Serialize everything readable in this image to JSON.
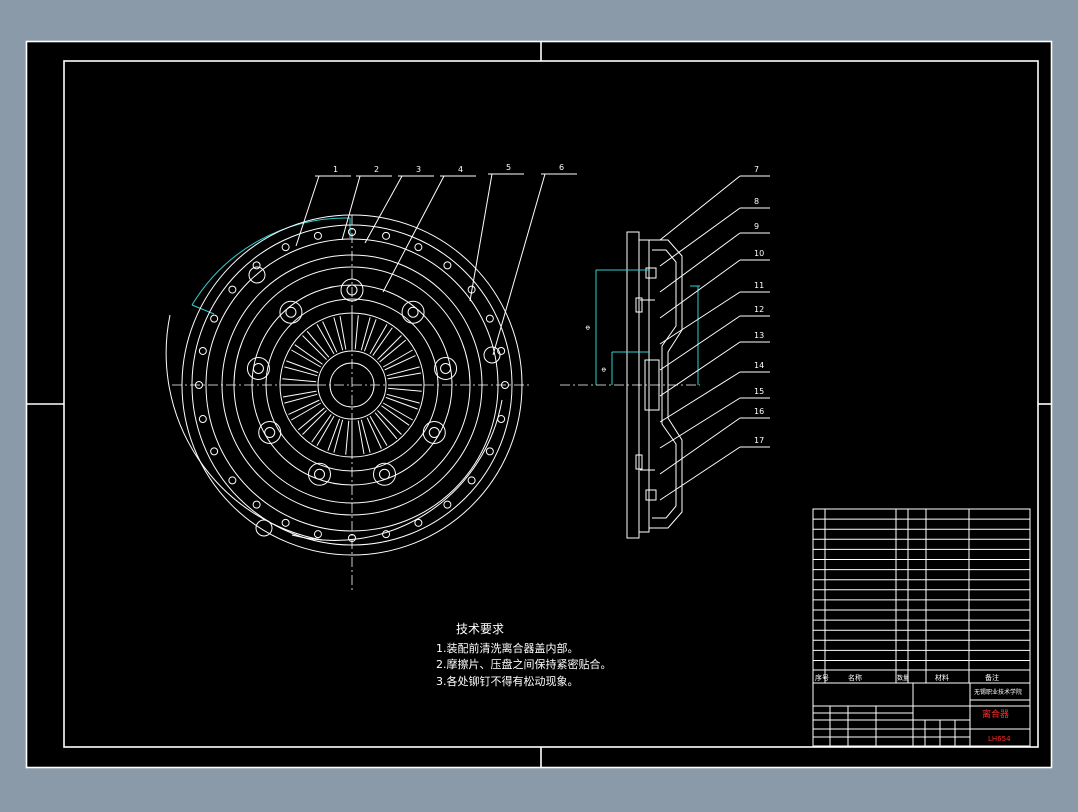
{
  "drawing": {
    "balloons": [
      "1",
      "2",
      "3",
      "4",
      "5",
      "6",
      "7",
      "8",
      "9",
      "10",
      "11",
      "12",
      "13",
      "14",
      "15",
      "16",
      "17"
    ]
  },
  "notes": {
    "title": "技术要求",
    "lines": [
      "1.装配前清洗离合器盖内部。",
      "2.摩擦片、压盘之间保持紧密贴合。",
      "3.各处铆钉不得有松动现象。"
    ]
  },
  "title_block": {
    "school": "无锡职业技术学院",
    "part_name": "离合器",
    "drawing_no": "LH654",
    "header_labels": [
      "序号",
      "名称",
      "数量",
      "材料",
      "备注"
    ],
    "colors": {
      "accent_red": "#ff2a2a",
      "accent_green": "#33ff33"
    }
  }
}
